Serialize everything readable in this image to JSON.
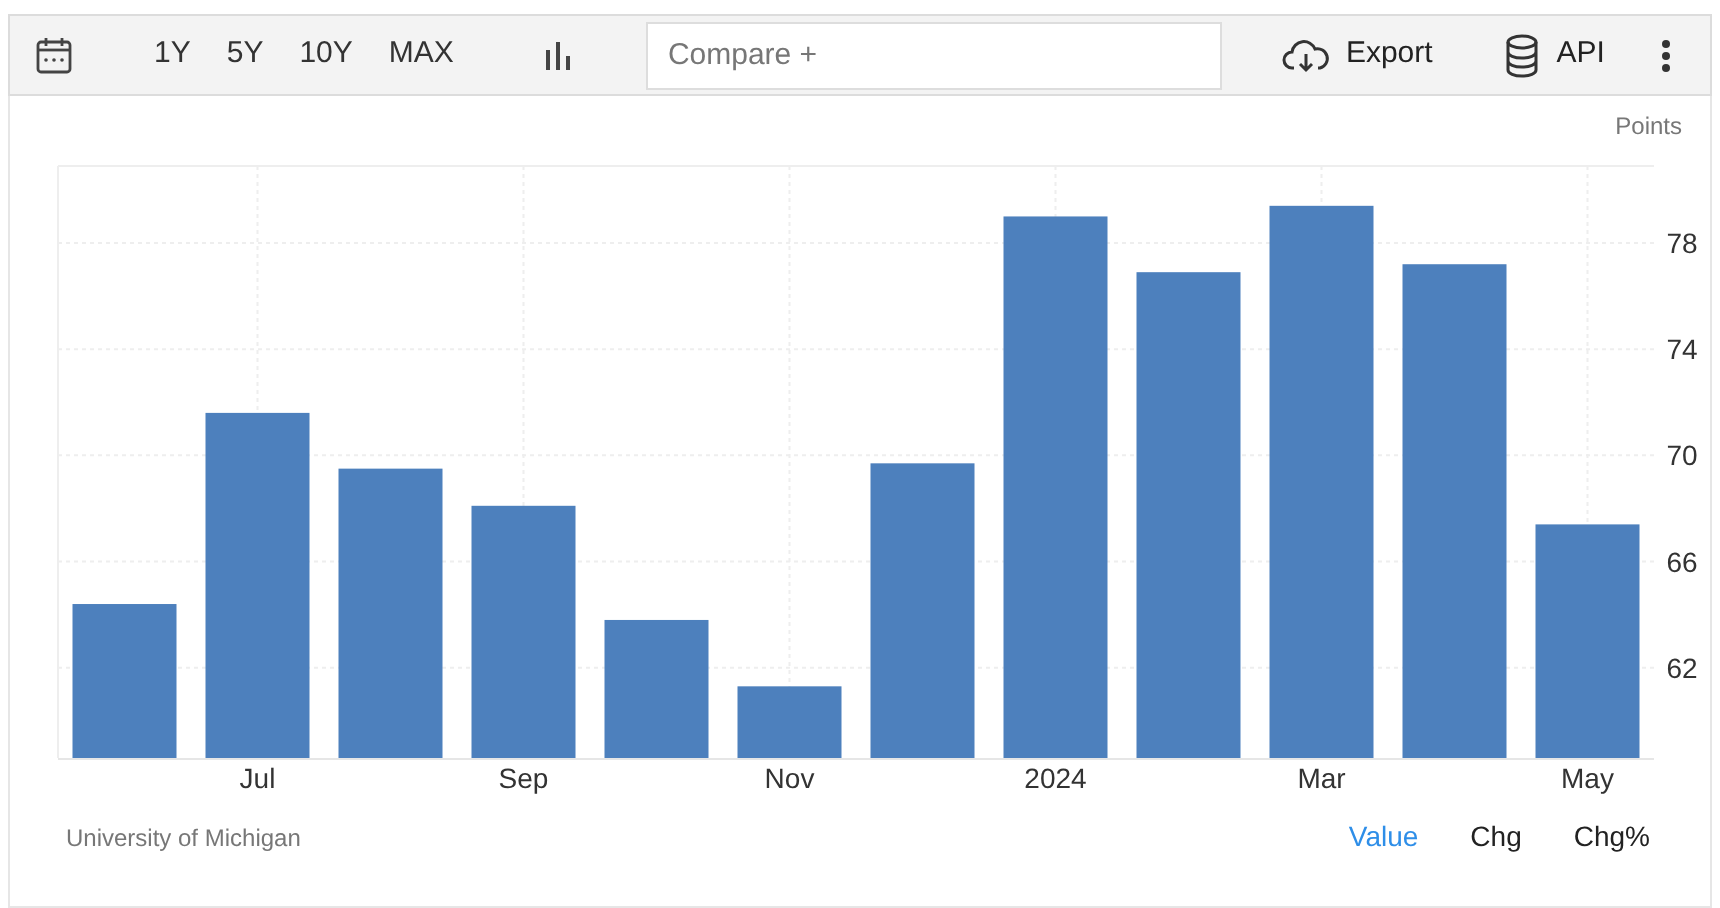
{
  "toolbar": {
    "ranges": [
      {
        "label": "1Y",
        "selected": false
      },
      {
        "label": "5Y",
        "selected": false
      },
      {
        "label": "10Y",
        "selected": false
      },
      {
        "label": "MAX",
        "selected": false
      }
    ],
    "compare": {
      "placeholder": "Compare +"
    },
    "export": "Export",
    "api": "API"
  },
  "chart": {
    "unit": "Points",
    "chart_data": {
      "type": "bar",
      "categories": [
        null,
        "Jul",
        null,
        "Sep",
        null,
        "Nov",
        null,
        "2024",
        null,
        "Mar",
        null,
        "May"
      ],
      "series": [
        {
          "color": "#4d80bd",
          "values": [
            64.4,
            71.6,
            69.5,
            68.1,
            63.8,
            61.3,
            69.7,
            79.0,
            76.9,
            79.4,
            77.2,
            67.4
          ]
        }
      ],
      "yticks": [
        62,
        66,
        70,
        74,
        78
      ],
      "ylim": [
        58.6,
        80.9
      ],
      "grid": true
    }
  },
  "source": "University of Michigan",
  "views": [
    {
      "label": "Value",
      "selected": true
    },
    {
      "label": "Chg",
      "selected": false
    },
    {
      "label": "Chg%",
      "selected": false
    }
  ]
}
